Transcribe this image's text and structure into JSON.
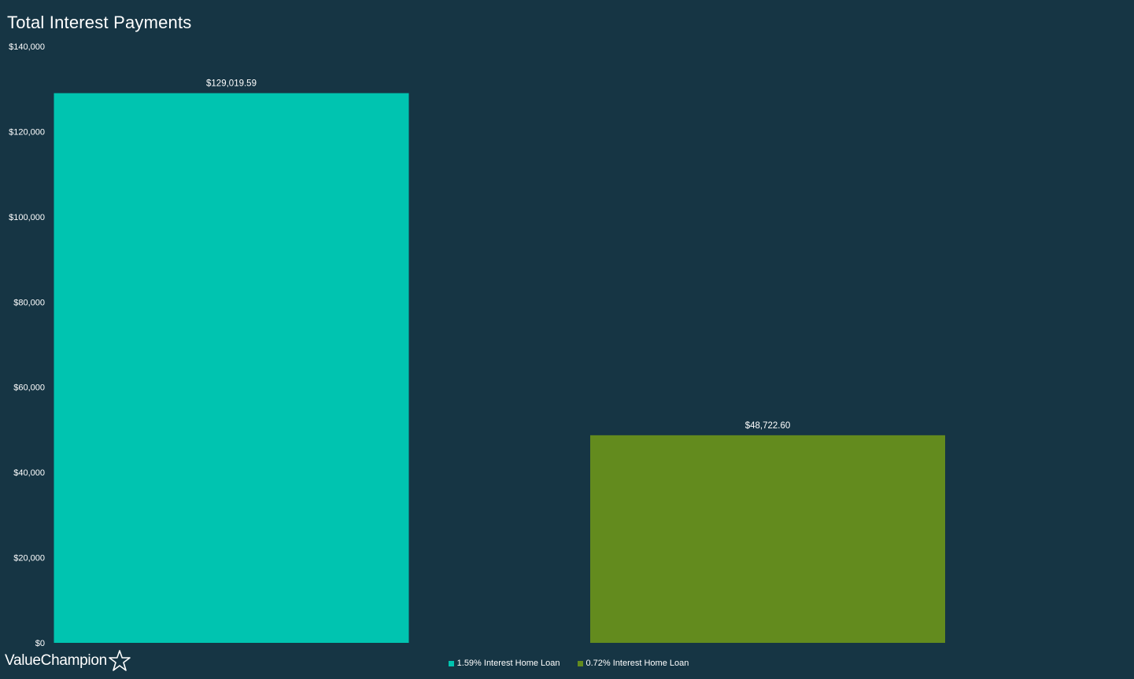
{
  "chart_data": {
    "type": "bar",
    "title": "Total Interest Payments",
    "categories": [
      "1.59% Interest Home Loan",
      "0.72% Interest Home Loan"
    ],
    "values": [
      129019.59,
      48722.6
    ],
    "data_labels": [
      "$129,019.59",
      "$48,722.60"
    ],
    "colors": [
      "#00c4b0",
      "#638b1e"
    ],
    "ylim": [
      0,
      140000
    ],
    "yticks": [
      0,
      20000,
      40000,
      60000,
      80000,
      100000,
      120000,
      140000
    ],
    "ytick_labels": [
      "$0",
      "$20,000",
      "$40,000",
      "$60,000",
      "$80,000",
      "$100,000",
      "$120,000",
      "$140,000"
    ],
    "xlabel": "",
    "ylabel": "",
    "grid": false,
    "legend_position": "bottom-center"
  },
  "legend": {
    "items": [
      {
        "label": "1.59% Interest Home Loan",
        "color": "#00c4b0"
      },
      {
        "label": "0.72% Interest Home Loan",
        "color": "#638b1e"
      }
    ]
  },
  "brand": {
    "name": "ValueChampion",
    "icon": "star-outline-icon"
  }
}
